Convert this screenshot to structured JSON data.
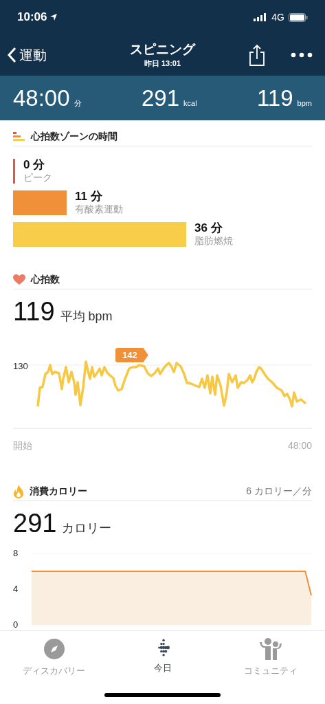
{
  "status_bar": {
    "time": "10:06",
    "network": "4G"
  },
  "nav": {
    "back": "運動",
    "title": "スピニング",
    "subtitle": "昨日 13:01"
  },
  "stats": [
    {
      "value": "48:00",
      "unit": "分"
    },
    {
      "value": "291",
      "unit": "kcal"
    },
    {
      "value": "119",
      "unit": "bpm"
    }
  ],
  "zones": {
    "title": "心拍数ゾーンの時間",
    "items": [
      {
        "minutes": "0 分",
        "label": "ピーク",
        "color": "#e8553d"
      },
      {
        "minutes": "11 分",
        "label": "有酸素運動",
        "color": "#f0913a"
      },
      {
        "minutes": "36 分",
        "label": "脂肪燃焼",
        "color": "#f7cd4a"
      }
    ]
  },
  "heart_rate": {
    "title": "心拍数",
    "value": "119",
    "unit": "平均 bpm",
    "marker": "142",
    "ytick": "130",
    "x_start": "開始",
    "x_end": "48:00"
  },
  "calories": {
    "title": "消費カロリー",
    "rate": "6 カロリー／分",
    "value": "291",
    "unit": "カロリー",
    "chart_data": {
      "type": "area",
      "categories": [
        null,
        null,
        null,
        null,
        null,
        null,
        null,
        null,
        null,
        null,
        null,
        null,
        null,
        null,
        null,
        null,
        null,
        null,
        null,
        null,
        null,
        null,
        null,
        null,
        null,
        null,
        null,
        null,
        null,
        null,
        null,
        null,
        null,
        null,
        null,
        null,
        null,
        null,
        null,
        null,
        null,
        null,
        null,
        null,
        null,
        null,
        null,
        null
      ],
      "values": [
        6,
        6,
        6,
        6,
        6,
        6,
        6,
        6,
        6,
        6,
        6,
        6,
        6,
        6,
        6,
        6,
        6,
        6,
        6,
        6,
        6,
        6,
        6,
        6,
        6,
        6,
        6,
        6,
        6,
        6,
        6,
        6,
        6,
        6,
        6,
        6,
        6,
        6,
        6,
        6,
        6,
        6,
        6,
        6,
        6,
        6,
        6,
        3.3
      ],
      "ylim": [
        0,
        8
      ],
      "yticks": [
        0,
        4,
        8
      ]
    }
  },
  "tab_bar": [
    {
      "label": "ディスカバリー",
      "selected": false
    },
    {
      "label": "今日",
      "selected": true
    },
    {
      "label": "コミュニティ",
      "selected": false
    }
  ]
}
